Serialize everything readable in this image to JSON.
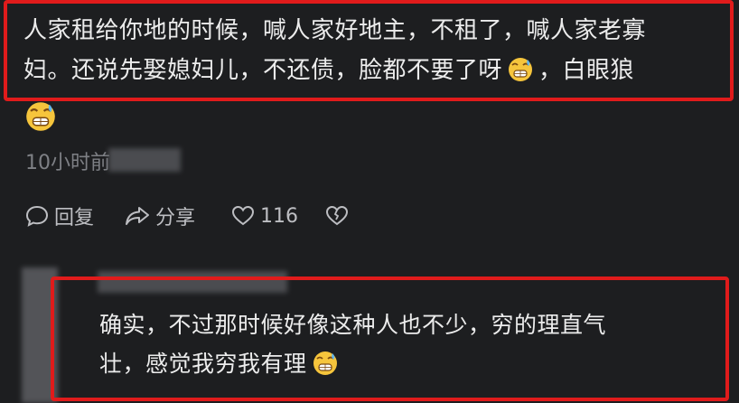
{
  "comment1": {
    "line1": "人家租给你地的时候，喊人家好地主，不租了，喊人家老寡",
    "line2_pre": "妇。还说先娶媳妇儿，不还债，脸都不要了呀",
    "line2_post": "，白眼狼",
    "emoji_icon": "grinning-sweat-emoji"
  },
  "meta": {
    "time": "10小时前"
  },
  "actions": {
    "reply": "回复",
    "share": "分享",
    "like_count": "116"
  },
  "comment2": {
    "line1": "确实，不过那时候好像这种人也不少，穷的理直气",
    "line2": "壮，感觉我穷我有理"
  },
  "colors": {
    "background": "#1d1e20",
    "highlight": "#e01b1b",
    "text": "#ececec",
    "meta": "#7e8085"
  }
}
